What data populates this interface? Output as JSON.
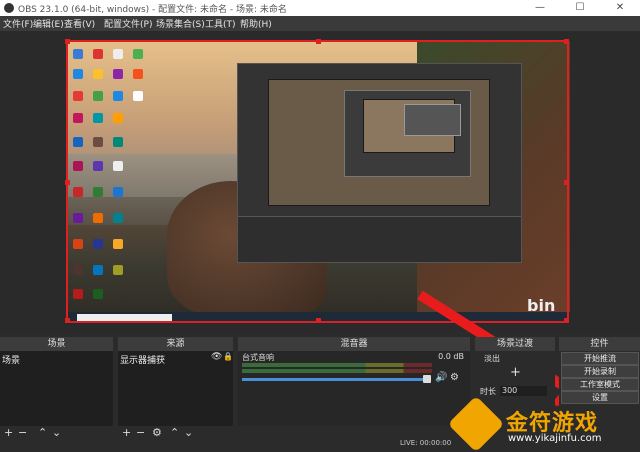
{
  "window": {
    "title": "OBS 23.1.0 (64-bit, windows) - 配置文件: 未命名 - 场景: 未命名",
    "minimize": "—",
    "maximize": "☐",
    "close": "✕"
  },
  "menu": [
    "文件(F)",
    "编辑(E)",
    "查看(V)",
    "配置文件(P)",
    "场景集合(S)",
    "工具(T)",
    "帮助(H)"
  ],
  "preview": {
    "brand_text": "bin"
  },
  "docks": {
    "scenes": {
      "title": "场景",
      "items": [
        "场景"
      ]
    },
    "sources": {
      "title": "来源",
      "items": [
        "显示器捕获"
      ]
    },
    "mixer": {
      "title": "混音器",
      "channel": "台式音响",
      "level": "0.0 dB"
    },
    "transitions": {
      "title": "场景过渡",
      "current": "淡出",
      "duration_label": "时长",
      "duration_value": "300"
    },
    "controls": {
      "title": "控件",
      "buttons": [
        "开始推流",
        "开始录制",
        "工作室模式",
        "设置"
      ]
    }
  },
  "status": {
    "live": "LIVE: 00:00:00"
  },
  "watermark": {
    "name": "金符游戏",
    "url": "www.yikajinfu.com"
  },
  "colors": {
    "selection": "#e02020",
    "accent": "#f0a500"
  }
}
